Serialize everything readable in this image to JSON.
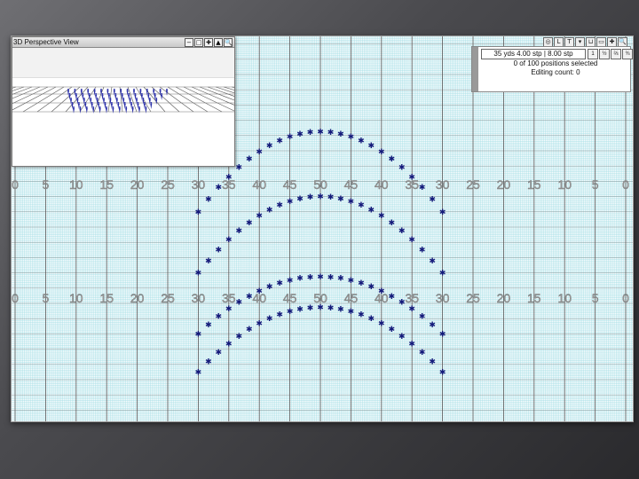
{
  "perspective_window": {
    "title": "3D Perspective View",
    "controls": [
      {
        "name": "minimize-icon",
        "glyph": "−"
      },
      {
        "name": "restore-icon",
        "glyph": "□"
      },
      {
        "name": "move-icon",
        "glyph": "✚"
      },
      {
        "name": "camera-icon",
        "glyph": "▲"
      },
      {
        "name": "zoom-icon",
        "glyph": "🔍"
      }
    ]
  },
  "info_panel": {
    "size_text": "35 yds 4.00 stp | 8.00 stp",
    "selection_text": "0 of 100 positions selected",
    "editing_text": "Editing count: 0",
    "buttons": [
      "1",
      "½",
      "⅔",
      "¾"
    ]
  },
  "top_toolbar": [
    "◎",
    "L",
    "T",
    "▾",
    "⊔",
    "▭",
    "✚",
    "🔍"
  ],
  "field": {
    "yard_numbers": [
      "0",
      "5",
      "10",
      "15",
      "20",
      "25",
      "30",
      "35",
      "40",
      "45",
      "50",
      "45",
      "40",
      "35",
      "30",
      "25",
      "20",
      "15",
      "10",
      "5",
      "0"
    ],
    "colors": {
      "grid_minor": "#a9e0e6",
      "grid_major": "#555555",
      "number_fill": "#9a9a9a",
      "marcher": "#141a7a"
    },
    "ranks": [
      {
        "from_yard": 30,
        "to_yard": 70,
        "end_step_y": 6,
        "peak_step_y": -15
      },
      {
        "from_yard": 30,
        "to_yard": 70,
        "end_step_y": 22,
        "peak_step_y": 2
      },
      {
        "from_yard": 30,
        "to_yard": 70,
        "end_step_y": 38,
        "peak_step_y": 23
      },
      {
        "from_yard": 30,
        "to_yard": 70,
        "end_step_y": 48,
        "peak_step_y": 31
      }
    ],
    "marchers_per_rank": 25
  }
}
